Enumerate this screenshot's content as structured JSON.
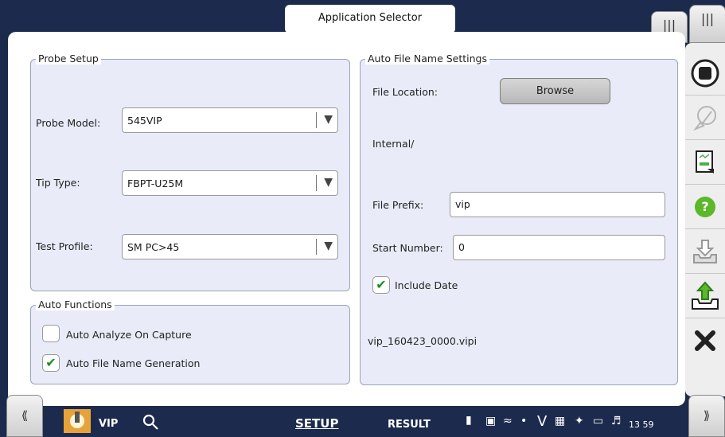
{
  "header": {
    "app_selector_label": "Application Selector",
    "tab_left_icon": "|||",
    "tab_right_icon": "|||"
  },
  "probe_setup": {
    "title": "Probe Setup",
    "probe_model_label": "Probe Model:",
    "probe_model_value": "545VIP",
    "tip_type_label": "Tip Type:",
    "tip_type_value": "FBPT-U25M",
    "test_profile_label": "Test Profile:",
    "test_profile_value": "SM PC>45"
  },
  "auto_functions": {
    "title": "Auto Functions",
    "auto_analyze_label": "Auto Analyze On Capture",
    "auto_analyze_checked": false,
    "auto_file_name_label": "Auto File Name Generation",
    "auto_file_name_checked": true
  },
  "auto_file_name_settings": {
    "title": "Auto File Name Settings",
    "file_location_label": "File Location:",
    "browse_label": "Browse",
    "location_value": "Internal/",
    "file_prefix_label": "File Prefix:",
    "file_prefix_value": "vip",
    "start_number_label": "Start Number:",
    "start_number_value": "0",
    "include_date_label": "Include Date",
    "include_date_checked": true,
    "file_name_preview": "vip_160423_0000.vipi"
  },
  "sidebar": {
    "icons": [
      "stop-icon",
      "pen-icon",
      "report-icon",
      "help-icon",
      "download-icon",
      "upload-icon",
      "close-icon"
    ],
    "help_glyph": "?"
  },
  "footer": {
    "left_tab_glyph": "⟪",
    "right_tab_glyph": "⟫",
    "app_name": "VIP",
    "setup_label": "SETUP",
    "result_label": "RESULT",
    "v_label": "V",
    "time": "13 59"
  },
  "colors": {
    "background": "#1c2b4d",
    "group_fill": "#e9ecf8",
    "check_green": "#1f8a1f",
    "help_green": "#5cb82a"
  }
}
